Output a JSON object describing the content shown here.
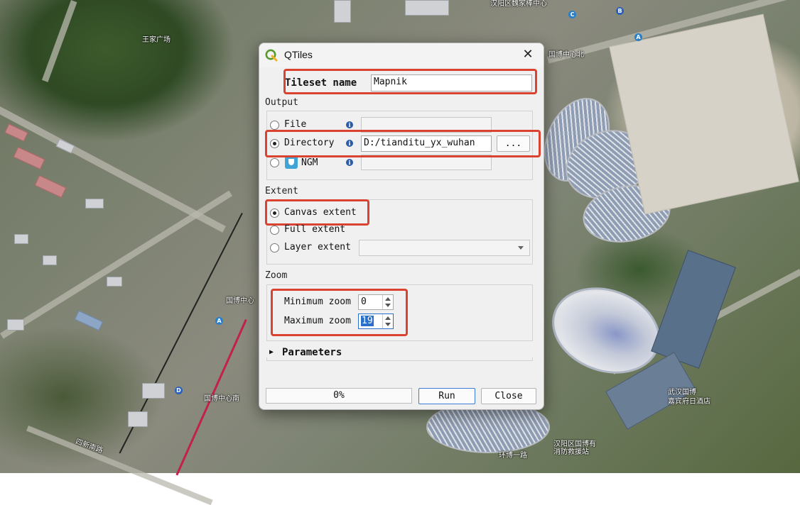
{
  "window": {
    "title": "QTiles",
    "close_glyph": "✕",
    "app_icon": "qgis-logo-icon"
  },
  "tileset": {
    "label": "Tileset name",
    "value": "Mapnik"
  },
  "output": {
    "section": "Output",
    "file": {
      "label": "File",
      "selected": false,
      "value": ""
    },
    "directory": {
      "label": "Directory",
      "selected": true,
      "value": "D:/tianditu_yx_wuhan",
      "browse": "..."
    },
    "ngm": {
      "label": "NGM",
      "selected": false,
      "value": ""
    },
    "info_glyph": "i"
  },
  "extent": {
    "section": "Extent",
    "canvas": {
      "label": "Canvas extent",
      "selected": true
    },
    "full": {
      "label": "Full extent",
      "selected": false
    },
    "layer": {
      "label": "Layer extent",
      "selected": false,
      "value": ""
    }
  },
  "zoom": {
    "section": "Zoom",
    "min": {
      "label": "Minimum zoom",
      "value": "0"
    },
    "max": {
      "label": "Maximum zoom",
      "value": "19"
    }
  },
  "parameters": {
    "label": "Parameters",
    "expander": "▶"
  },
  "footer": {
    "progress": "0%",
    "run": "Run",
    "close": "Close"
  },
  "map_labels": [
    "汉阳区魏家棒中心",
    "国博中心北",
    "武汉国博",
    "嘉宾府日酒店",
    "汉阳区国博有",
    "消防救援站",
    "国博中心南",
    "王家广场",
    "环博一路",
    "国博中心",
    "四新南路"
  ],
  "metro_markers": [
    "C",
    "B",
    "A",
    "A",
    "D"
  ],
  "colors": {
    "highlight": "#d9432f",
    "info": "#2a5ba8"
  }
}
